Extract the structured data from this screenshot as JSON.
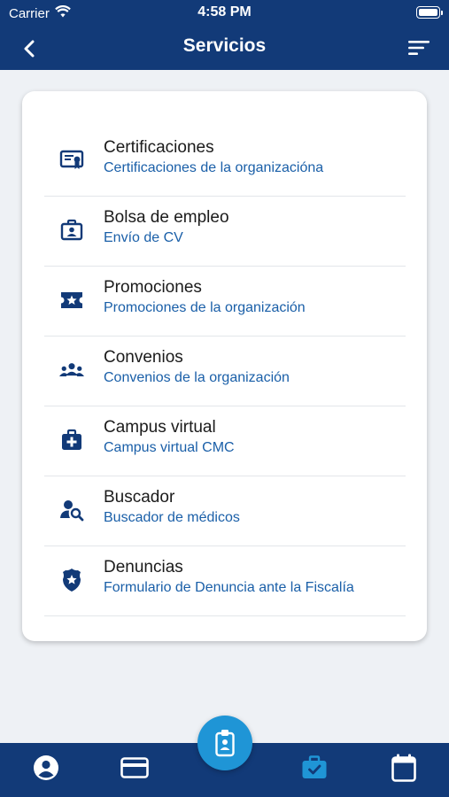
{
  "status_bar": {
    "carrier": "Carrier",
    "time": "4:58 PM"
  },
  "header": {
    "title": "Servicios"
  },
  "colors": {
    "primary": "#123a78",
    "accent": "#1f95d6",
    "subtitle": "#1a5fa8"
  },
  "services": [
    {
      "title": "Certificaciones",
      "subtitle": "Certificaciones de la organizacióna",
      "icon": "certificate-icon"
    },
    {
      "title": "Bolsa de empleo",
      "subtitle": "Envío de CV",
      "icon": "briefcase-id-icon"
    },
    {
      "title": "Promociones",
      "subtitle": "Promociones de la organización",
      "icon": "ticket-star-icon"
    },
    {
      "title": "Convenios",
      "subtitle": "Convenios de la organización",
      "icon": "group-icon"
    },
    {
      "title": "Campus virtual",
      "subtitle": "Campus virtual CMC",
      "icon": "medical-bag-icon"
    },
    {
      "title": "Buscador",
      "subtitle": "Buscador de médicos",
      "icon": "user-search-icon"
    },
    {
      "title": "Denuncias",
      "subtitle": "Formulario de Denuncia ante la Fiscalía",
      "icon": "police-badge-icon"
    }
  ],
  "tabbar": {
    "tabs": [
      {
        "icon": "profile-icon",
        "active": false
      },
      {
        "icon": "credit-card-icon",
        "active": false
      },
      {
        "icon": "badge-id-icon",
        "active": false,
        "center": true
      },
      {
        "icon": "briefcase-check-icon",
        "active": true
      },
      {
        "icon": "calendar-icon",
        "active": false
      }
    ]
  }
}
